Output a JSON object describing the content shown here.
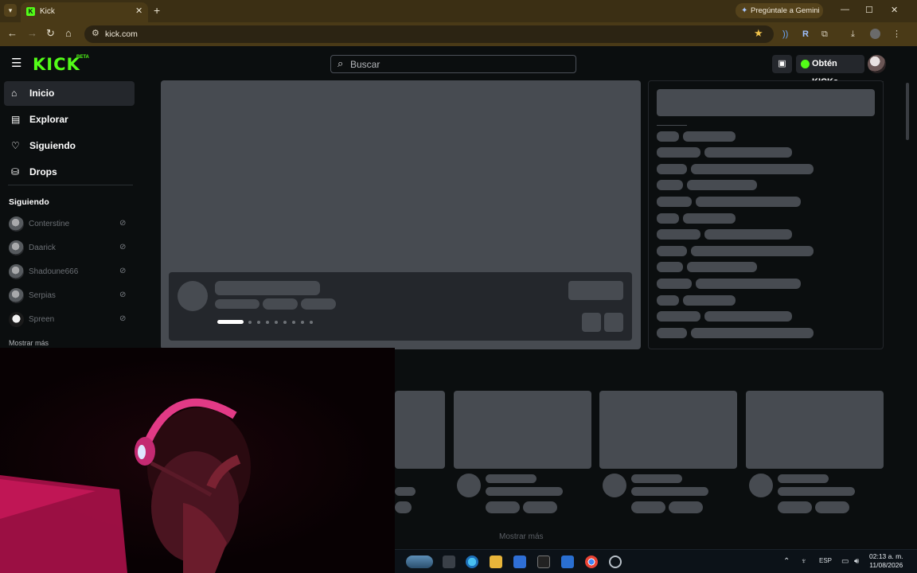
{
  "browser": {
    "tab_list_icon": "chevron-down-icon",
    "tab_title": "Kick",
    "favicon_letter": "K",
    "close_tab_glyph": "✕",
    "new_tab_glyph": "+",
    "gemini_label": "Pregúntale a Gemini",
    "url": "kick.com",
    "window_controls": {
      "minimize": "—",
      "maximize": "☐",
      "close": "✕"
    },
    "nav": {
      "back": "←",
      "forward": "→",
      "reload": "↻",
      "home": "⌂"
    }
  },
  "kick": {
    "logo": "KICK",
    "logo_badge": "BETA",
    "search_placeholder": "Buscar",
    "get_kicks_label": "Obtén KICKs",
    "accent_color": "#53fc18"
  },
  "sidebar": {
    "nav_items": [
      {
        "label": "Inicio",
        "icon": "home-icon",
        "active": true
      },
      {
        "label": "Explorar",
        "icon": "compass-icon",
        "active": false
      },
      {
        "label": "Siguiendo",
        "icon": "heart-icon",
        "active": false
      },
      {
        "label": "Drops",
        "icon": "drops-icon",
        "active": false
      }
    ],
    "following_title": "Siguiendo",
    "channels": [
      {
        "name": "Conterstine"
      },
      {
        "name": "Daarick"
      },
      {
        "name": "Shadoune666"
      },
      {
        "name": "Serpias"
      },
      {
        "name": "Spreen"
      }
    ],
    "show_more": "Mostrar más"
  },
  "main": {
    "show_more": "Mostrar más"
  },
  "taskbar": {
    "language": "ESP",
    "time": "02:13 a. m.",
    "date": "11/08/2026"
  }
}
